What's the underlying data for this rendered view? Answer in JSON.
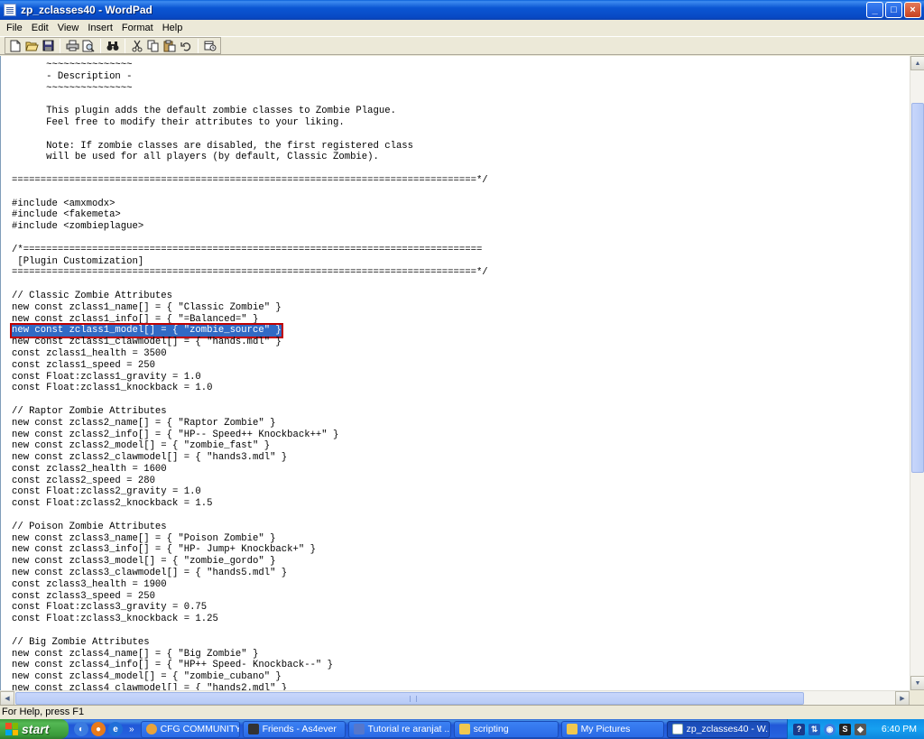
{
  "window": {
    "title": "zp_zclasses40 - WordPad",
    "minimize": "_",
    "maximize": "□",
    "close": "×"
  },
  "menu": [
    "File",
    "Edit",
    "View",
    "Insert",
    "Format",
    "Help"
  ],
  "toolbar": {
    "icons": [
      "new-document-icon",
      "open-folder-icon",
      "save-disk-icon",
      "print-icon",
      "print-preview-icon",
      "find-binoculars-icon",
      "cut-scissors-icon",
      "copy-icon",
      "paste-icon",
      "undo-icon",
      "date-time-icon"
    ]
  },
  "document": {
    "lines": [
      "      ~~~~~~~~~~~~~~~",
      "      - Description -",
      "      ~~~~~~~~~~~~~~~",
      "",
      "      This plugin adds the default zombie classes to Zombie Plague.",
      "      Feel free to modify their attributes to your liking.",
      "",
      "      Note: If zombie classes are disabled, the first registered class",
      "      will be used for all players (by default, Classic Zombie).",
      "",
      "=================================================================================*/",
      "",
      "#include <amxmodx>",
      "#include <fakemeta>",
      "#include <zombieplague>",
      "",
      "/*================================================================================",
      " [Plugin Customization]",
      "=================================================================================*/",
      "",
      "// Classic Zombie Attributes",
      "new const zclass1_name[] = { \"Classic Zombie\" }",
      "new const zclass1_info[] = { \"=Balanced=\" }",
      "new const zclass1_model[] = { \"zombie_source\" }",
      "new const zclass1_clawmodel[] = { \"hands.mdl\" }",
      "const zclass1_health = 3500",
      "const zclass1_speed = 250",
      "const Float:zclass1_gravity = 1.0",
      "const Float:zclass1_knockback = 1.0",
      "",
      "// Raptor Zombie Attributes",
      "new const zclass2_name[] = { \"Raptor Zombie\" }",
      "new const zclass2_info[] = { \"HP-- Speed++ Knockback++\" }",
      "new const zclass2_model[] = { \"zombie_fast\" }",
      "new const zclass2_clawmodel[] = { \"hands3.mdl\" }",
      "const zclass2_health = 1600",
      "const zclass2_speed = 280",
      "const Float:zclass2_gravity = 1.0",
      "const Float:zclass2_knockback = 1.5",
      "",
      "// Poison Zombie Attributes",
      "new const zclass3_name[] = { \"Poison Zombie\" }",
      "new const zclass3_info[] = { \"HP- Jump+ Knockback+\" }",
      "new const zclass3_model[] = { \"zombie_gordo\" }",
      "new const zclass3_clawmodel[] = { \"hands5.mdl\" }",
      "const zclass3_health = 1900",
      "const zclass3_speed = 250",
      "const Float:zclass3_gravity = 0.75",
      "const Float:zclass3_knockback = 1.25",
      "",
      "// Big Zombie Attributes",
      "new const zclass4_name[] = { \"Big Zombie\" }",
      "new const zclass4_info[] = { \"HP++ Speed- Knockback--\" }",
      "new const zclass4_model[] = { \"zombie_cubano\" }",
      "new const zclass4_clawmodel[] = { \"hands2.mdl\" }"
    ],
    "selected_line": 23
  },
  "status": {
    "text": "For Help, press F1"
  },
  "taskbar": {
    "start_label": "start",
    "quick_launch_more": "»",
    "tasks": [
      {
        "label": "CFG COMMUNITY ...",
        "color": "#e8a33a"
      },
      {
        "label": "Friends - As4ever",
        "color": "#333333"
      },
      {
        "label": "Tutorial re aranjat ...",
        "color": "#5577cc"
      },
      {
        "label": "scripting",
        "color": "#f0c850"
      },
      {
        "label": "My Pictures",
        "color": "#f0c850"
      },
      {
        "label": "zp_zclasses40 - W...",
        "color": "#ffffff",
        "active": true
      }
    ],
    "clock": "6:40 PM"
  },
  "colors": {
    "selection": "#316ac5",
    "highlight_box": "#c00000"
  }
}
